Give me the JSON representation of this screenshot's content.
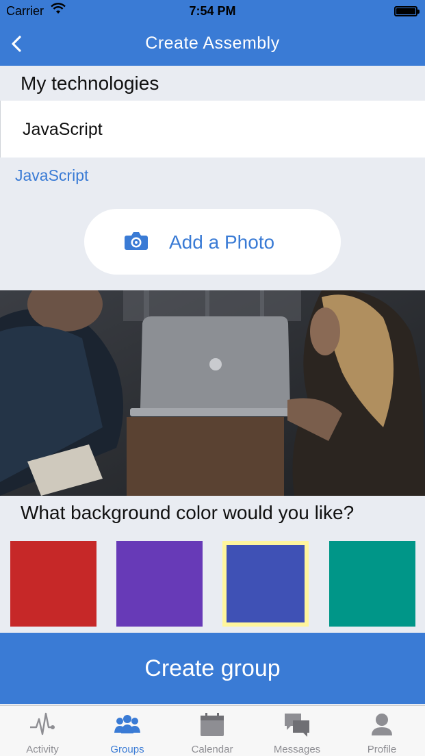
{
  "status_bar": {
    "carrier": "Carrier",
    "time": "7:54 PM"
  },
  "nav": {
    "title": "Create Assembly",
    "back_icon": "chevron-left-icon"
  },
  "technologies": {
    "label": "My technologies",
    "input_value": "JavaScript",
    "selected_tag": "JavaScript"
  },
  "photo": {
    "button_label": "Add a Photo",
    "icon": "camera-icon"
  },
  "hero_image": {
    "description_icon": "photo-people-laptop"
  },
  "colors": {
    "question": "What background color would you like?",
    "swatches": [
      {
        "name": "red",
        "hex": "#c62828",
        "selected": false
      },
      {
        "name": "purple",
        "hex": "#673ab7",
        "selected": false
      },
      {
        "name": "indigo",
        "hex": "#3f51b5",
        "selected": true
      },
      {
        "name": "teal",
        "hex": "#009688",
        "selected": false
      }
    ],
    "selected_border": "#fff59d"
  },
  "create": {
    "label": "Create group"
  },
  "tabbar": {
    "active_color": "#3a7bd5",
    "inactive_color": "#8e8e93",
    "tabs": [
      {
        "label": "Activity",
        "icon": "pulse-icon",
        "active": false
      },
      {
        "label": "Groups",
        "icon": "groups-icon",
        "active": true
      },
      {
        "label": "Calendar",
        "icon": "calendar-icon",
        "active": false
      },
      {
        "label": "Messages",
        "icon": "messages-icon",
        "active": false
      },
      {
        "label": "Profile",
        "icon": "profile-icon",
        "active": false
      }
    ]
  },
  "theme": {
    "primary": "#3a7bd5",
    "background": "#e9ecf2"
  }
}
